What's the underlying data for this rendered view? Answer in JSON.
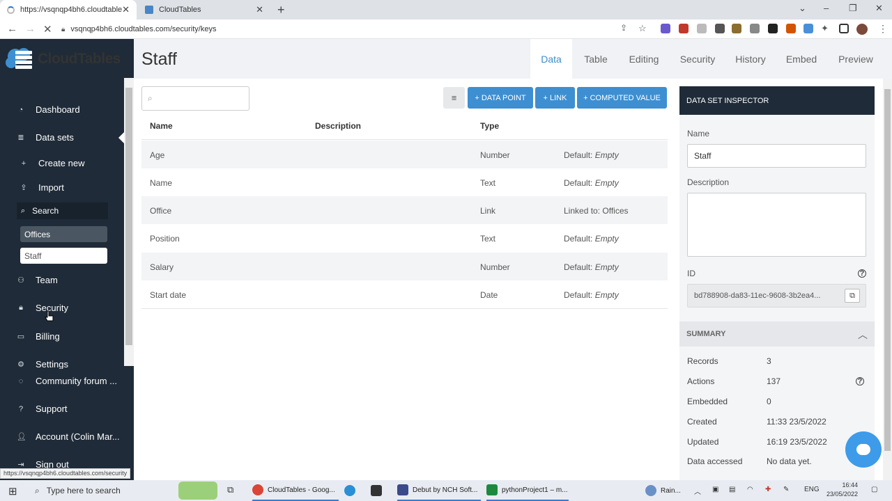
{
  "browser": {
    "tabs": [
      {
        "title": "https://vsqnqp4bh6.cloudtables.c"
      },
      {
        "title": "CloudTables"
      }
    ],
    "url": "vsqnqp4bh6.cloudtables.com/security/keys",
    "status_url": "https://vsqnqp4bh6.cloudtables.com/security"
  },
  "sidebar": {
    "brand": "CloudTables",
    "items": [
      {
        "label": "Dashboard"
      },
      {
        "label": "Data sets"
      },
      {
        "label": "Create new"
      },
      {
        "label": "Import"
      },
      {
        "label": "Team"
      },
      {
        "label": "Security"
      },
      {
        "label": "Billing"
      },
      {
        "label": "Settings"
      },
      {
        "label": "Community forum ..."
      },
      {
        "label": "Support"
      },
      {
        "label": "Account (Colin Mar..."
      },
      {
        "label": "Sign out"
      }
    ],
    "search_label": "Search",
    "datasets": [
      "Offices",
      "Staff"
    ]
  },
  "header": {
    "title": "Staff",
    "tabs": [
      "Data",
      "Table",
      "Editing",
      "Security",
      "History",
      "Embed",
      "Preview"
    ]
  },
  "toolbar": {
    "buttons": [
      "+ DATA POINT",
      "+ LINK",
      "+ COMPUTED VALUE"
    ]
  },
  "table": {
    "columns": [
      "Name",
      "Description",
      "Type"
    ],
    "rows": [
      {
        "name": "Age",
        "type": "Number",
        "meta_prefix": "Default: ",
        "meta_value": "Empty"
      },
      {
        "name": "Name",
        "type": "Text",
        "meta_prefix": "Default: ",
        "meta_value": "Empty"
      },
      {
        "name": "Office",
        "type": "Link",
        "meta_prefix": "Linked to: Offices",
        "meta_value": ""
      },
      {
        "name": "Position",
        "type": "Text",
        "meta_prefix": "Default: ",
        "meta_value": "Empty"
      },
      {
        "name": "Salary",
        "type": "Number",
        "meta_prefix": "Default: ",
        "meta_value": "Empty"
      },
      {
        "name": "Start date",
        "type": "Date",
        "meta_prefix": "Default: ",
        "meta_value": "Empty"
      }
    ]
  },
  "inspector": {
    "title": "DATA SET INSPECTOR",
    "name_label": "Name",
    "name_value": "Staff",
    "description_label": "Description",
    "id_label": "ID",
    "id_value": "bd788908-da83-11ec-9608-3b2ea4...",
    "summary_title": "SUMMARY",
    "summary": [
      {
        "label": "Records",
        "value": "3"
      },
      {
        "label": "Actions",
        "value": "137"
      },
      {
        "label": "Embedded",
        "value": "0"
      },
      {
        "label": "Created",
        "value": "11:33 23/5/2022"
      },
      {
        "label": "Updated",
        "value": "16:19 23/5/2022"
      },
      {
        "label": "Data accessed",
        "value": "No data yet."
      }
    ]
  },
  "taskbar": {
    "search_placeholder": "Type here to search",
    "apps": [
      "CloudTables - Goog...",
      "Debut by NCH Soft...",
      "pythonProject1 – m..."
    ],
    "weather": "Rain...",
    "lang": "ENG",
    "time": "16:44",
    "date": "23/05/2022"
  }
}
